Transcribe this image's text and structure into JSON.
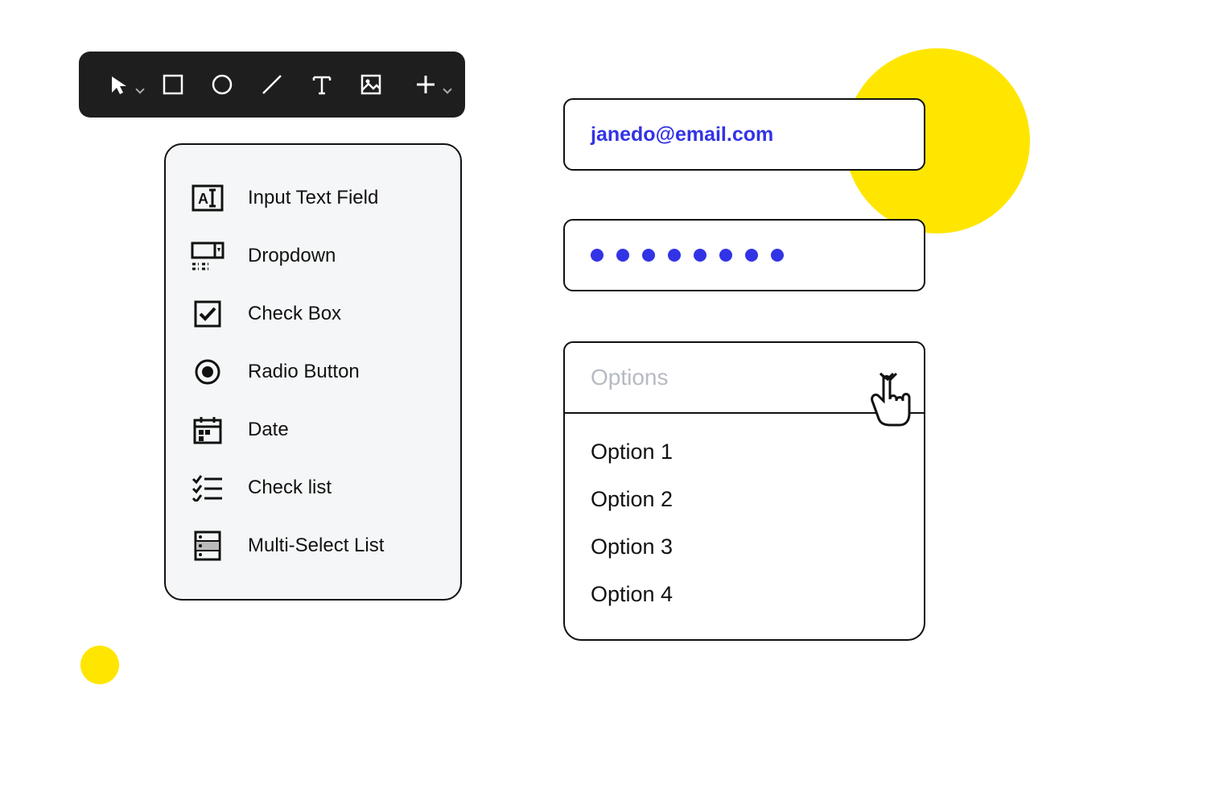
{
  "panel": {
    "items": [
      {
        "label": "Input Text Field"
      },
      {
        "label": "Dropdown"
      },
      {
        "label": "Check Box"
      },
      {
        "label": "Radio Button"
      },
      {
        "label": "Date"
      },
      {
        "label": "Check list"
      },
      {
        "label": "Multi-Select List"
      }
    ]
  },
  "form": {
    "email": "janedo@email.com",
    "password_dots": 8,
    "select": {
      "placeholder": "Options",
      "options": [
        "Option 1",
        "Option 2",
        "Option 3",
        "Option 4"
      ]
    }
  },
  "colors": {
    "accent": "#3333e6",
    "highlight": "#ffe600"
  }
}
